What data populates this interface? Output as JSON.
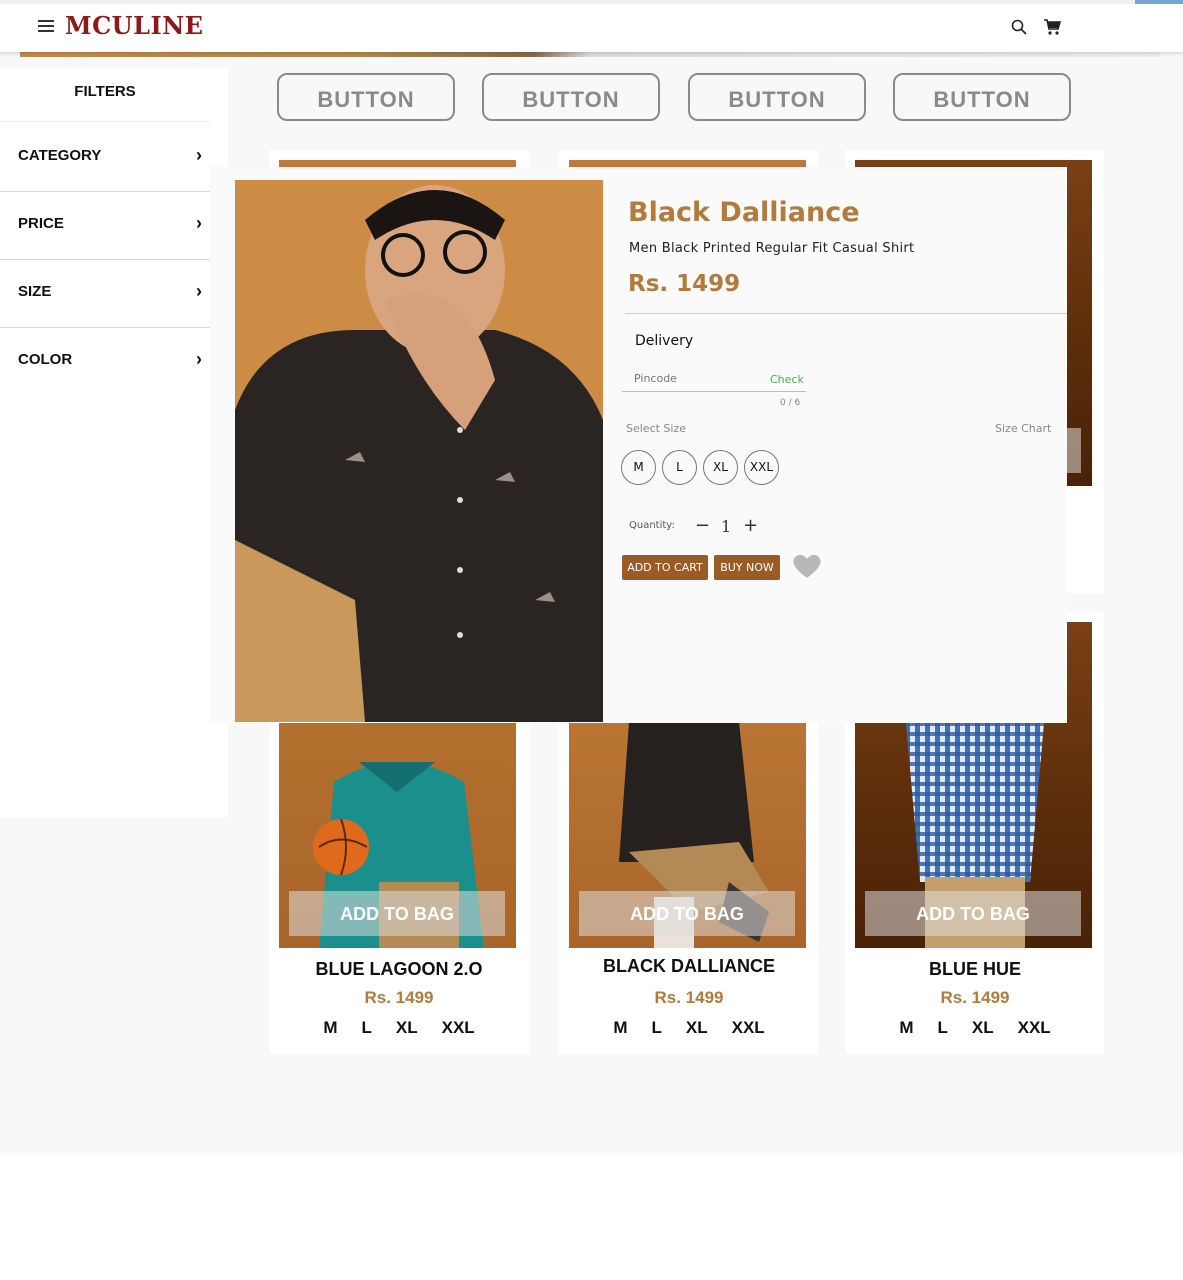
{
  "header": {
    "logo": "MCULINE"
  },
  "sidebar": {
    "title": "FILTERS",
    "items": [
      {
        "label": "CATEGORY"
      },
      {
        "label": "PRICE"
      },
      {
        "label": "SIZE"
      },
      {
        "label": "COLOR"
      }
    ]
  },
  "top_buttons": [
    "BUTTON",
    "BUTTON",
    "BUTTON",
    "BUTTON"
  ],
  "products": [
    {
      "name": "BLUE LAGOON 2.O",
      "price": "Rs. 1499",
      "bag": "ADD TO BAG",
      "sizes": [
        "M",
        "L",
        "XL",
        "XXL"
      ]
    },
    {
      "name": "BLACK DALLIANCE",
      "price": "Rs. 1499",
      "bag": "ADD TO BAG",
      "sizes": [
        "M",
        "L",
        "XL",
        "XXL"
      ]
    },
    {
      "name": "BLUE HUE",
      "price": "Rs. 1499",
      "bag": "ADD TO BAG",
      "sizes": [
        "M",
        "L",
        "XL",
        "XXL"
      ]
    }
  ],
  "modal": {
    "title": "Black Dalliance",
    "subtitle": "Men Black Printed Regular Fit Casual Shirt",
    "price": "Rs. 1499",
    "delivery": "Delivery",
    "pincode_placeholder": "Pincode",
    "check": "Check",
    "counter": "0 / 6",
    "select_size": "Select Size",
    "size_chart": "Size Chart",
    "sizes": [
      "M",
      "L",
      "XL",
      "XXL"
    ],
    "quantity_label": "Quantity:",
    "quantity": "1",
    "minus": "−",
    "plus": "+",
    "add_to_cart": "ADD TO CART",
    "buy_now": "BUY NOW"
  },
  "colors": {
    "brand": "#8b1a1a",
    "accent_gold": "#b27a3c",
    "button_brown": "#9c5a25",
    "check_green": "#4caf50"
  }
}
